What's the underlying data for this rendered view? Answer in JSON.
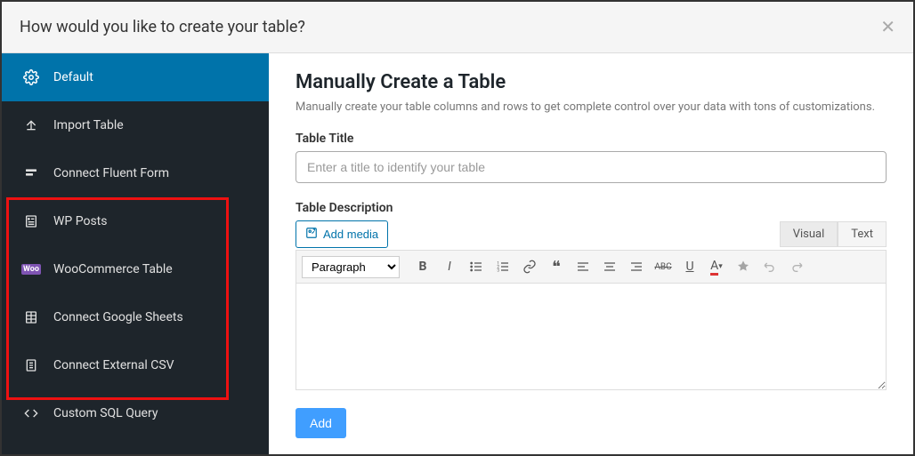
{
  "modal": {
    "title": "How would you like to create your table?"
  },
  "sidebar": {
    "items": [
      {
        "label": "Default",
        "icon": "gear"
      },
      {
        "label": "Import Table",
        "icon": "upload"
      },
      {
        "label": "Connect Fluent Form",
        "icon": "form"
      },
      {
        "label": "WP Posts",
        "icon": "posts"
      },
      {
        "label": "WooCommerce Table",
        "icon": "woo"
      },
      {
        "label": "Connect Google Sheets",
        "icon": "sheets"
      },
      {
        "label": "Connect External CSV",
        "icon": "csv"
      },
      {
        "label": "Custom SQL Query",
        "icon": "code"
      }
    ]
  },
  "content": {
    "title": "Manually Create a Table",
    "subtitle": "Manually create your table columns and rows to get complete control over your data with tons of customizations.",
    "table_title_label": "Table Title",
    "table_title_placeholder": "Enter a title to identify your table",
    "table_desc_label": "Table Description",
    "add_media_label": "Add media",
    "tabs": {
      "visual": "Visual",
      "text": "Text"
    },
    "format_select": "Paragraph",
    "add_button": "Add",
    "abc": "ABC"
  }
}
